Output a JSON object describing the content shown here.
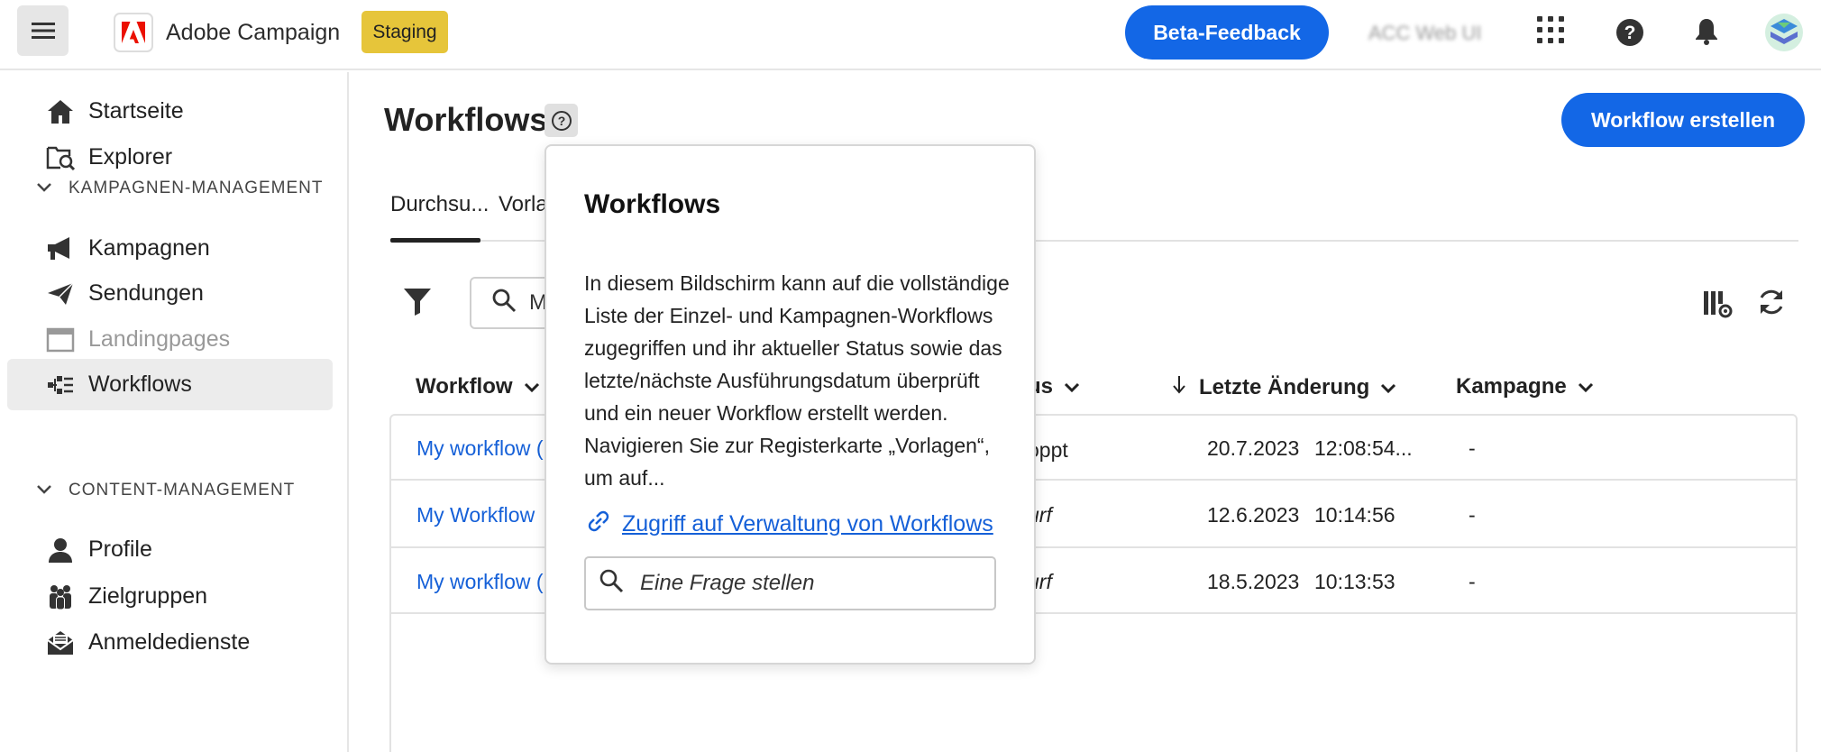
{
  "topbar": {
    "app_name": "Adobe Campaign",
    "env_badge": "Staging",
    "beta_feedback": "Beta-Feedback",
    "org_name": "ACC Web UI"
  },
  "sidebar": {
    "items_top": [
      {
        "label": "Startseite",
        "icon": "home-icon"
      },
      {
        "label": "Explorer",
        "icon": "explorer-icon"
      }
    ],
    "section1": "KAMPAGNEN-MANAGEMENT",
    "items_campaign": [
      {
        "label": "Kampagnen",
        "icon": "megaphone-icon"
      },
      {
        "label": "Sendungen",
        "icon": "send-icon"
      },
      {
        "label": "Landingpages",
        "icon": "landing-page-icon"
      },
      {
        "label": "Workflows",
        "icon": "workflow-icon"
      }
    ],
    "section2": "CONTENT-MANAGEMENT",
    "items_content": [
      {
        "label": "Profile",
        "icon": "user-icon"
      },
      {
        "label": "Zielgruppen",
        "icon": "audiences-icon"
      },
      {
        "label": "Anmeldedienste",
        "icon": "subscription-icon"
      }
    ]
  },
  "main": {
    "title": "Workflows",
    "create_button": "Workflow erstellen",
    "tabs": [
      "Durchsu...",
      "Vorla"
    ],
    "search_value": "M",
    "columns": [
      "Workflow",
      "us",
      "Letzte Änderung",
      "Kampagne"
    ],
    "rows": [
      {
        "workflow": "My workflow (",
        "status": "oppt",
        "date": "20.7.2023",
        "time": "12:08:54...",
        "campaign": "-"
      },
      {
        "workflow": "My Workflow",
        "status": "urf",
        "date": "12.6.2023",
        "time": "10:14:56",
        "campaign": "-"
      },
      {
        "workflow": "My workflow (",
        "status": "urf",
        "date": "18.5.2023",
        "time": "10:13:53",
        "campaign": "-"
      }
    ]
  },
  "popover": {
    "title": "Workflows",
    "body": "In diesem Bildschirm kann auf die vollständige Liste der Einzel- und Kampagnen-Workflows zugegriffen und ihr aktueller Status sowie das letzte/nächste Ausführungsdatum überprüft und ein neuer Workflow erstellt werden. Navigieren Sie zur Registerkarte „Vorlagen“, um auf...",
    "link": "Zugriff auf Verwaltung von Workflows",
    "ask_placeholder": "Eine Frage stellen"
  },
  "colors": {
    "accent": "#1367e6",
    "staging": "#e6c53a",
    "link": "#1560d8"
  }
}
